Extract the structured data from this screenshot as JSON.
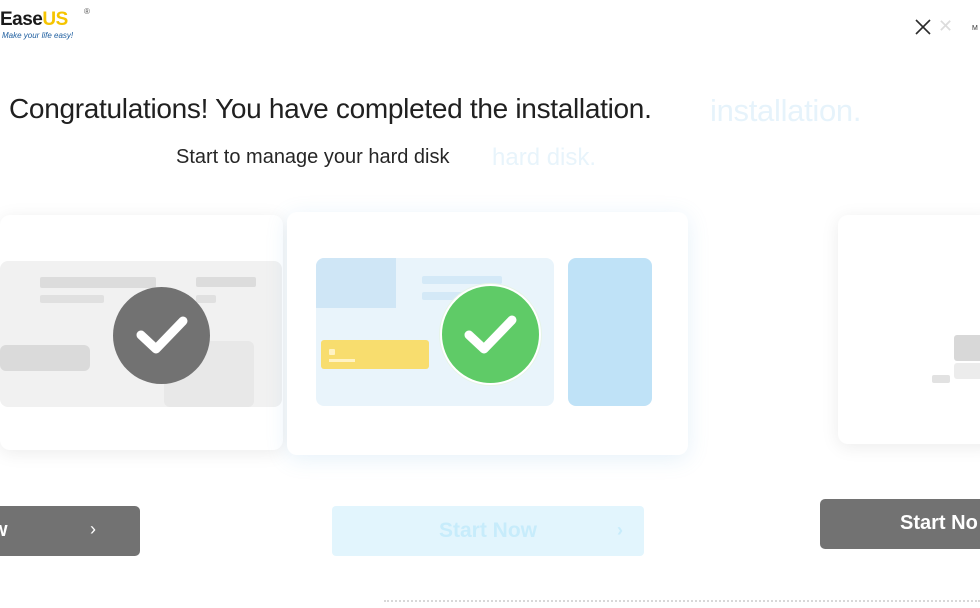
{
  "logo": {
    "brand_prefix": "Ease",
    "brand_suffix": "US",
    "registered": "®",
    "tagline": "Make your life easy!"
  },
  "window": {
    "close_icon": "close-icon",
    "close_label_fragment": "M"
  },
  "heading": {
    "title": "Congratulations! You have completed the installation.",
    "title_ghost": "installation.",
    "subtitle": "Start to manage your hard disk",
    "subtitle_ghost": "hard disk."
  },
  "cards": {
    "main_badge_icon": "check-circle-icon",
    "left_badge_icon": "check-circle-icon",
    "accent_colors": {
      "success": "#5fcb67",
      "tile_blue": "#bfe2f7",
      "tag_yellow": "#f8dd6e"
    }
  },
  "actions": {
    "start_now_label": "Start Now",
    "start_now_chevron": "›",
    "left_ghost_label": "w",
    "left_ghost_chevron": "›",
    "right_ghost_label": "Start No"
  }
}
